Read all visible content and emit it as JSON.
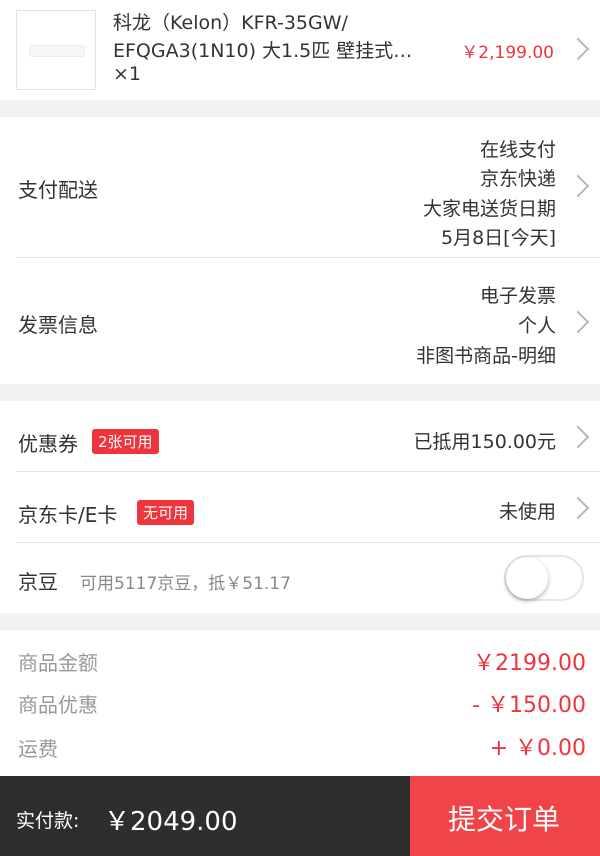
{
  "product": {
    "name_line1": "科龙（Kelon）KFR-35GW/",
    "name_line2": "EFQGA3(1N10) 大1.5匹 壁挂式…",
    "quantity": "×1",
    "price": "￥2,199.00"
  },
  "payment": {
    "label": "支付配送",
    "lines": [
      "在线支付",
      "京东快递",
      "大家电送货日期",
      "5月8日[今天]"
    ]
  },
  "invoice": {
    "label": "发票信息",
    "lines": [
      "电子发票",
      "个人",
      "非图书商品-明细"
    ]
  },
  "coupon": {
    "label": "优惠券",
    "badge": "2张可用",
    "value": "已抵用150.00元"
  },
  "jdcard": {
    "label": "京东卡/E卡",
    "badge": "无可用",
    "value": "未使用"
  },
  "jingdou": {
    "label": "京豆",
    "desc": "可用5117京豆，抵￥51.17",
    "toggle_on": false
  },
  "summary": {
    "items": [
      {
        "label": "商品金额",
        "value": "￥2199.00"
      },
      {
        "label": "商品优惠",
        "value": "- ￥150.00"
      },
      {
        "label": "运费",
        "value": "+ ￥0.00"
      }
    ]
  },
  "footer": {
    "total_label": "实付款:",
    "total_value": "￥2049.00",
    "submit_label": "提交订单"
  },
  "colors": {
    "accent": "#f0343e",
    "footer_bg": "#2e2e2e",
    "submit_bg": "#f04448"
  }
}
